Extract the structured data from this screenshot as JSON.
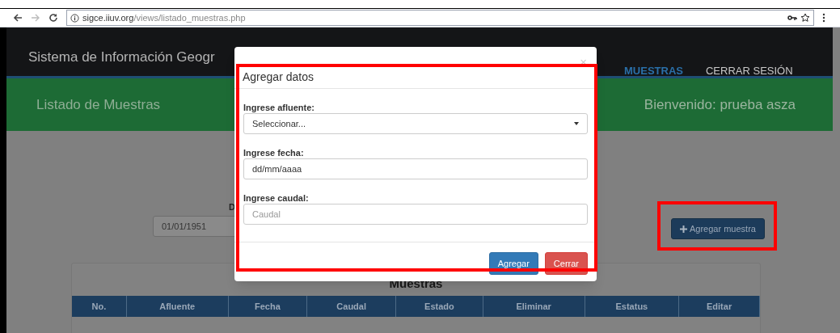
{
  "browser": {
    "url_host": "sigce.iiuv.org",
    "url_path": "/views/listado_muestras.php"
  },
  "navbar": {
    "brand": "Sistema de Información Geogr",
    "links": [
      {
        "label": "MUESTRAS",
        "selected": true
      },
      {
        "label": "CERRAR SESIÓN",
        "selected": false
      }
    ]
  },
  "banner": {
    "title": "Listado de Muestras",
    "welcome": "Bienvenido: prueba asza"
  },
  "filter": {
    "label": "D",
    "date_value": "01/01/1951"
  },
  "add_button": {
    "label": "Agregar muestra"
  },
  "table": {
    "title": "Muestras",
    "columns": [
      "No.",
      "Afluente",
      "Fecha",
      "Caudal",
      "Estado",
      "Eliminar",
      "Estatus",
      "Editar"
    ]
  },
  "modal": {
    "title": "Agregar datos",
    "close": "×",
    "fields": [
      {
        "kind": "select",
        "label": "Ingrese afluente:",
        "value": "Seleccionar..."
      },
      {
        "kind": "date",
        "label": "Ingrese fecha:",
        "value": "dd/mm/aaaa"
      },
      {
        "kind": "text",
        "label": "Ingrese caudal:",
        "placeholder": "Caudal"
      }
    ],
    "buttons": [
      {
        "label": "Agregar",
        "kind": "primary"
      },
      {
        "label": "Cerrar",
        "kind": "danger"
      }
    ]
  }
}
